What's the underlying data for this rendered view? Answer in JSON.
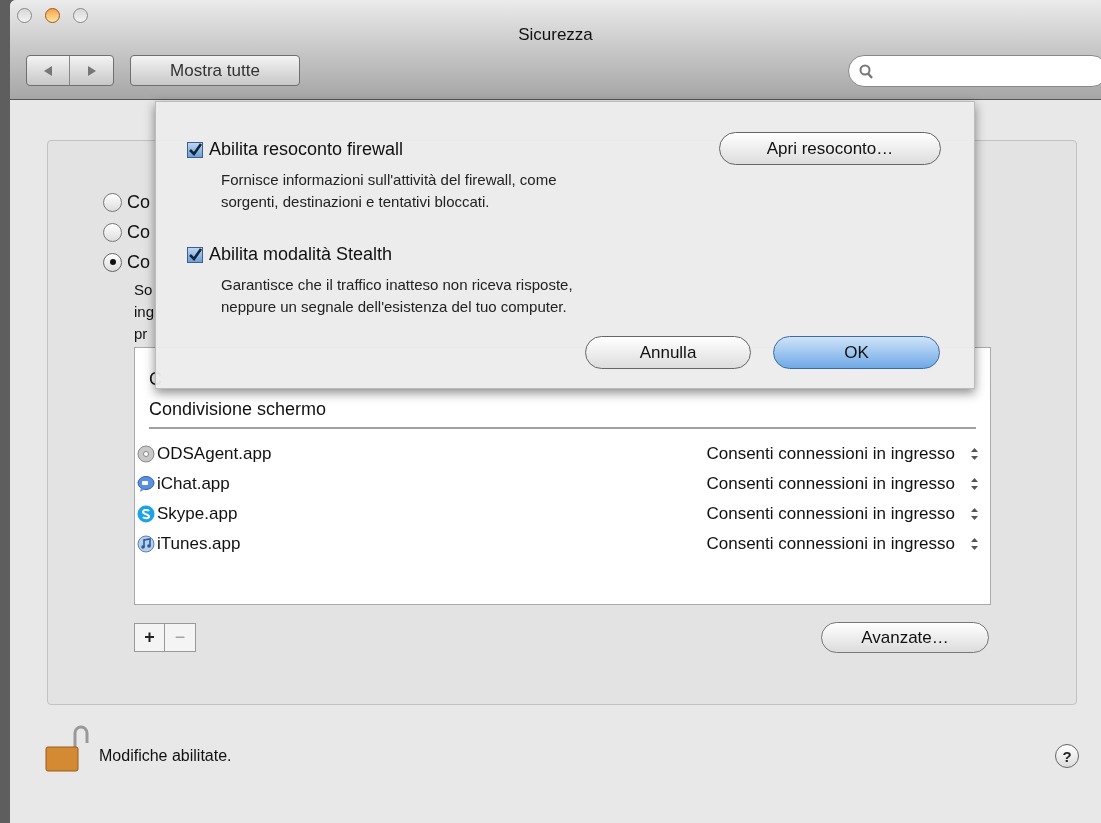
{
  "window": {
    "title": "Sicurezza"
  },
  "toolbar": {
    "show_all": "Mostra tutte"
  },
  "firewall": {
    "radios": [
      {
        "label": "Co",
        "selected": false
      },
      {
        "label": "Co",
        "selected": false
      },
      {
        "label": "Co",
        "selected": true
      }
    ],
    "description_fragments": [
      "So",
      "ing",
      "pr"
    ],
    "services": [
      "C",
      "Condivisione schermo"
    ],
    "apps": [
      {
        "name": "ODSAgent.app",
        "kind": "disc",
        "setting": "Consenti connessioni in ingresso"
      },
      {
        "name": "iChat.app",
        "kind": "chat",
        "setting": "Consenti connessioni in ingresso"
      },
      {
        "name": "Skype.app",
        "kind": "skype",
        "setting": "Consenti connessioni in ingresso"
      },
      {
        "name": "iTunes.app",
        "kind": "music",
        "setting": "Consenti connessioni in ingresso"
      }
    ],
    "add": "+",
    "remove": "−",
    "advanced": "Avanzate…"
  },
  "footer": {
    "lock_text": "Modifiche abilitate.",
    "help": "?"
  },
  "sheet": {
    "options": [
      {
        "label": "Abilita resoconto firewall",
        "checked": true,
        "description": [
          "Fornisce informazioni sull'attività del firewall, come",
          "sorgenti, destinazioni e tentativi bloccati."
        ]
      },
      {
        "label": "Abilita modalità Stealth",
        "checked": true,
        "description": [
          "Garantisce che il traffico inatteso non riceva risposte,",
          "neppure un segnale dell'esistenza del tuo computer."
        ]
      }
    ],
    "open_log": "Apri resoconto…",
    "cancel": "Annulla",
    "ok": "OK"
  }
}
